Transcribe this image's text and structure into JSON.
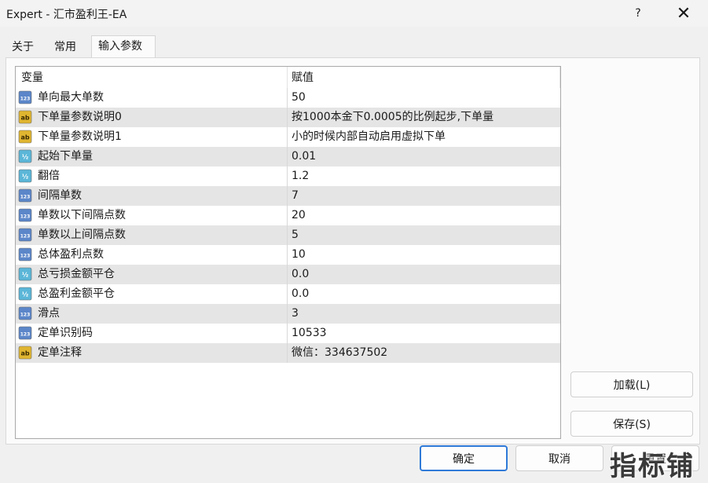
{
  "window": {
    "title": "Expert - 汇市盈利王-EA",
    "help_label": "?",
    "close_label": "✕"
  },
  "tabs": [
    {
      "label": "关于"
    },
    {
      "label": "常用"
    },
    {
      "label": "输入参数",
      "active": true
    }
  ],
  "grid": {
    "columns": {
      "variable": "变量",
      "value": "赋值"
    },
    "rows": [
      {
        "icon": "int-icon",
        "name": "单向最大单数",
        "value": "50"
      },
      {
        "icon": "string-icon",
        "name": "下单量参数说明0",
        "value": "按1000本金下0.0005的比例起步,下单量"
      },
      {
        "icon": "string-icon",
        "name": "下单量参数说明1",
        "value": "小的时候内部自动启用虚拟下单"
      },
      {
        "icon": "double-icon",
        "name": "起始下单量",
        "value": "0.01"
      },
      {
        "icon": "double-icon",
        "name": "翻倍",
        "value": "1.2"
      },
      {
        "icon": "int-icon",
        "name": "间隔单数",
        "value": "7"
      },
      {
        "icon": "int-icon",
        "name": "单数以下间隔点数",
        "value": "20"
      },
      {
        "icon": "int-icon",
        "name": "单数以上间隔点数",
        "value": "5"
      },
      {
        "icon": "int-icon",
        "name": "总体盈利点数",
        "value": "10"
      },
      {
        "icon": "double-icon",
        "name": "总亏损金额平仓",
        "value": "0.0"
      },
      {
        "icon": "double-icon",
        "name": "总盈利金额平仓",
        "value": "0.0"
      },
      {
        "icon": "int-icon",
        "name": "滑点",
        "value": "3"
      },
      {
        "icon": "int-icon",
        "name": "定单识别码",
        "value": "10533"
      },
      {
        "icon": "string-icon",
        "name": "定单注释",
        "value": "微信：334637502"
      }
    ]
  },
  "buttons": {
    "load": "加载(L)",
    "save": "保存(S)",
    "ok": "确定",
    "cancel": "取消",
    "reset": "重置"
  },
  "watermark": "指标铺",
  "icon_text": {
    "int": "123",
    "string": "ab",
    "double": "½"
  },
  "colors": {
    "int_icon": "#5b86c9",
    "string_icon": "#e0b530",
    "double_icon": "#5bb6d8",
    "ok_border": "#2f7ad8"
  }
}
